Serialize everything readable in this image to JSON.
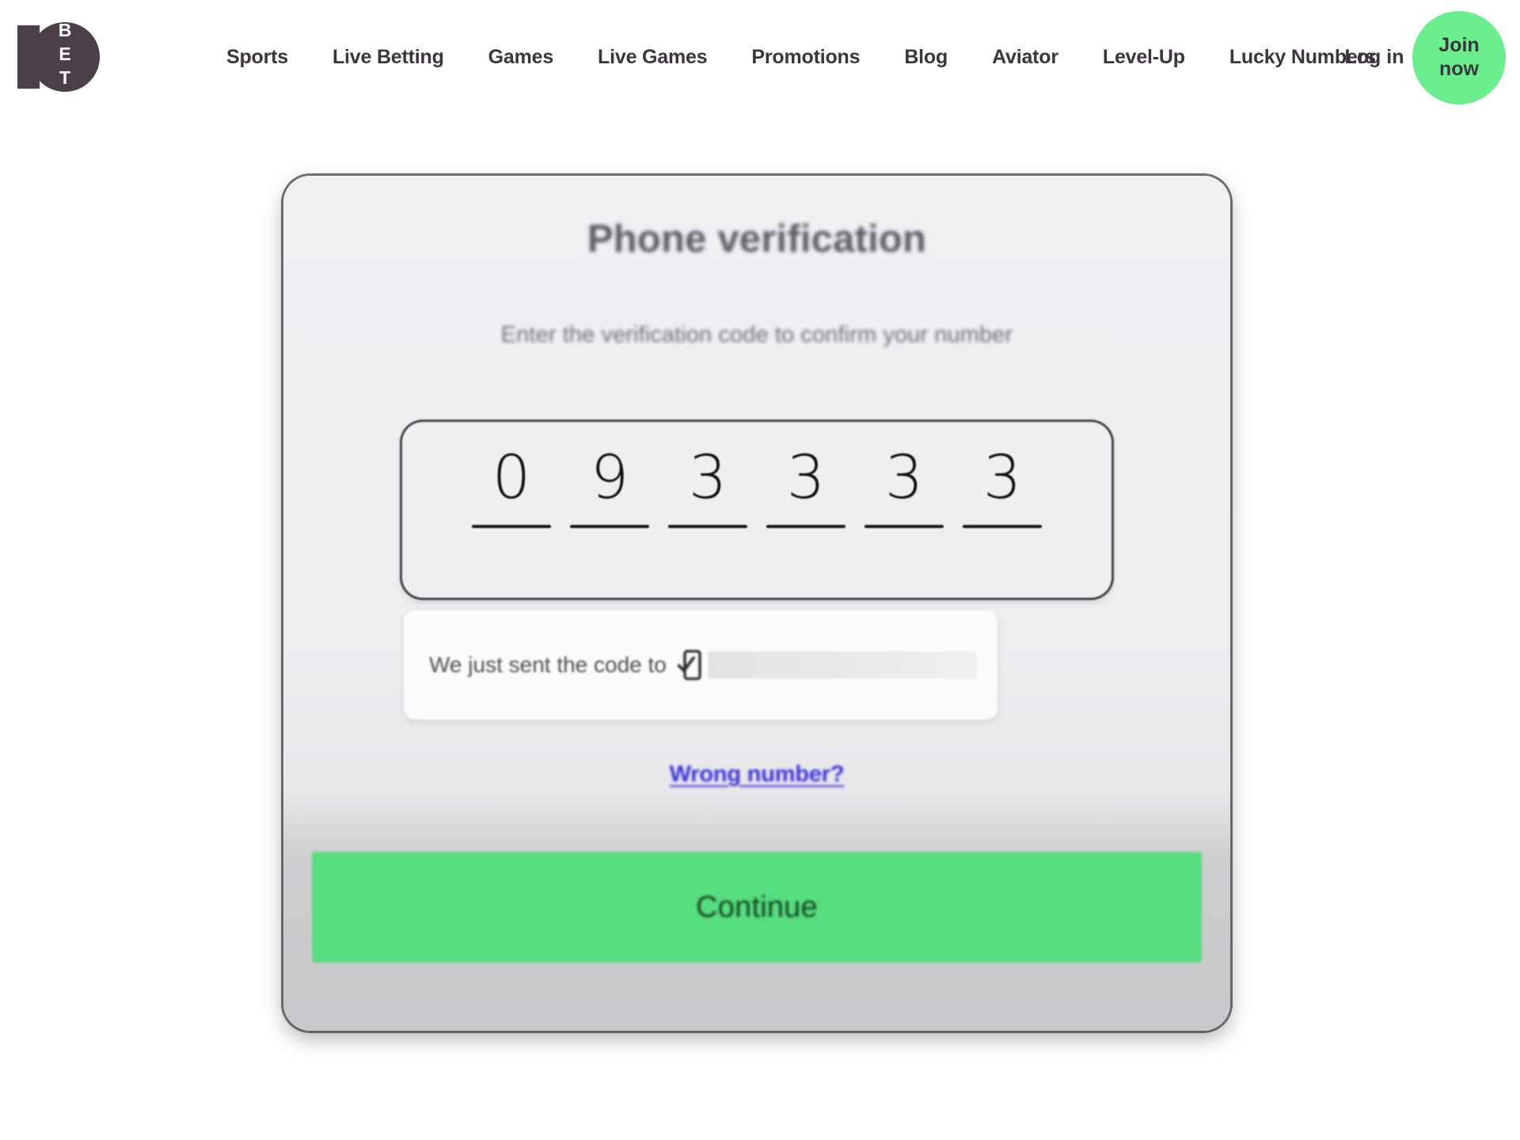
{
  "header": {
    "logo": {
      "name": "10bet-logo",
      "numeral": "10",
      "letters": [
        "B",
        "E",
        "T"
      ],
      "color": "#4b4047"
    },
    "nav_items": [
      {
        "label": "Sports"
      },
      {
        "label": "Live Betting"
      },
      {
        "label": "Games"
      },
      {
        "label": "Live Games"
      },
      {
        "label": "Promotions"
      },
      {
        "label": "Blog"
      },
      {
        "label": "Aviator"
      },
      {
        "label": "Level-Up"
      },
      {
        "label": "Lucky Numbers"
      }
    ],
    "login_label": "Log in",
    "join_label_line1": "Join",
    "join_label_line2": "now",
    "join_color": "#6aee8e",
    "nav_text_color": "#3d3440"
  },
  "modal": {
    "title": "Phone verification",
    "subtitle": "Enter the verification code to confirm your number",
    "otp": {
      "digits": [
        "0",
        "9",
        "3",
        "3",
        "3",
        "3"
      ],
      "length": 6,
      "code": "093333"
    },
    "sent_notice": {
      "text": "We just sent the code to",
      "icon": "mobile-check-icon",
      "phone_number": ""
    },
    "wrong_number_label": "Wrong number?",
    "wrong_number_color": "#3a30d8",
    "continue_label": "Continue",
    "continue_color": "#56dd7f"
  }
}
